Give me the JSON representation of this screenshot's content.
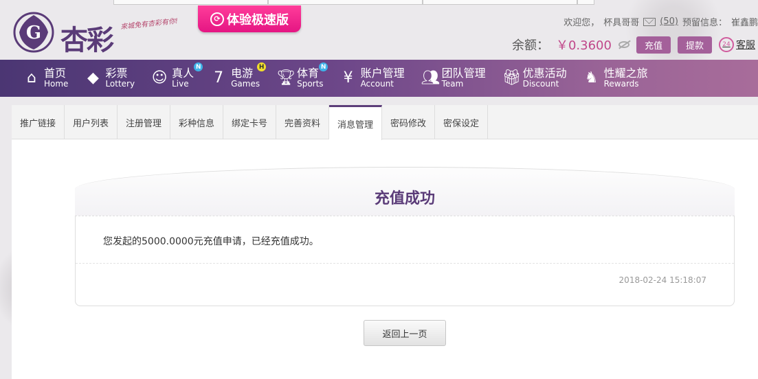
{
  "header": {
    "logo_text": "杏彩",
    "slogan": "來城免有杏彩有你!",
    "promo_label": "体验极速版",
    "welcome": "欢迎您，",
    "username": "杯具哥哥",
    "mail_count": "(50)",
    "reserved_info_label": "预留信息：",
    "reserved_info_value": "崔鑫鹏",
    "balance_label": "余额：",
    "balance_value": "￥0.3600",
    "deposit_label": "充值",
    "withdraw_label": "提款",
    "service_label": "客服",
    "service_icon_text": "24"
  },
  "nav": {
    "items": [
      {
        "cn": "首页",
        "en": "Home",
        "icon": "home-icon"
      },
      {
        "cn": "彩票",
        "en": "Lottery",
        "icon": "lottery-icon"
      },
      {
        "cn": "真人",
        "en": "Live",
        "icon": "live-icon",
        "badge": "N"
      },
      {
        "cn": "电游",
        "en": "Games",
        "icon": "slot-7-icon",
        "badge": "H"
      },
      {
        "cn": "体育",
        "en": "Sports",
        "icon": "trophy-icon",
        "badge": "N"
      },
      {
        "cn": "账户管理",
        "en": "Account",
        "icon": "yen-coin-icon"
      },
      {
        "cn": "团队管理",
        "en": "Team",
        "icon": "team-icon"
      },
      {
        "cn": "优惠活动",
        "en": "Discount",
        "icon": "gift-icon"
      },
      {
        "cn": "性耀之旅",
        "en": "Rewards",
        "icon": "rewards-icon"
      }
    ]
  },
  "tabs": [
    "推广链接",
    "用户列表",
    "注册管理",
    "彩种信息",
    "绑定卡号",
    "完善资料",
    "消息管理",
    "密码修改",
    "密保设定"
  ],
  "active_tab": "消息管理",
  "message": {
    "title": "充值成功",
    "body": "您发起的5000.0000元充值申请，已经充值成功。",
    "timestamp": "2018-02-24 15:18:07"
  },
  "back_button_label": "返回上一页",
  "colors": {
    "brand_purple": "#5a3b78",
    "promo_pink": "#e51583",
    "balance_pink": "#c0478a",
    "button_purple": "#a4609a"
  }
}
